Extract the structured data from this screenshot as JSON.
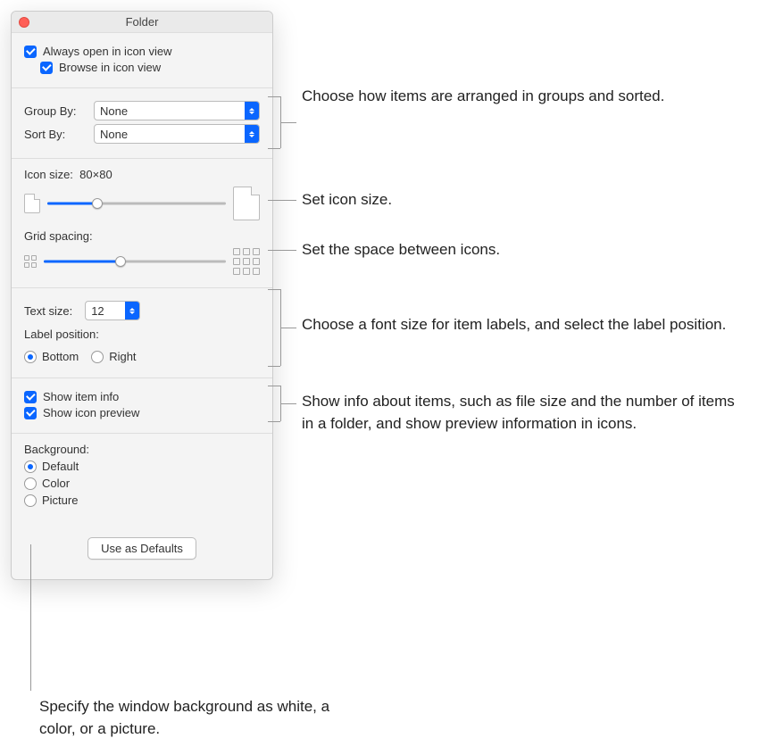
{
  "title": "Folder",
  "view": {
    "always_open_icon_view": "Always open in icon view",
    "browse_icon_view": "Browse in icon view"
  },
  "arrange": {
    "group_by_label": "Group By:",
    "group_by_value": "None",
    "sort_by_label": "Sort By:",
    "sort_by_value": "None"
  },
  "icon_size": {
    "label": "Icon size:",
    "value": "80×80",
    "slider_percent": 28
  },
  "grid_spacing": {
    "label": "Grid spacing:",
    "slider_percent": 42
  },
  "text": {
    "text_size_label": "Text size:",
    "text_size_value": "12",
    "label_position_label": "Label position:",
    "bottom": "Bottom",
    "right": "Right"
  },
  "info": {
    "show_item_info": "Show item info",
    "show_icon_preview": "Show icon preview"
  },
  "background": {
    "label": "Background:",
    "default": "Default",
    "color": "Color",
    "picture": "Picture"
  },
  "footer": {
    "use_defaults": "Use as Defaults"
  },
  "callouts": {
    "arrange": "Choose how items are arranged in groups and sorted.",
    "icon_size": "Set icon size.",
    "grid_spacing": "Set the space between icons.",
    "text": "Choose a font size for item labels, and select the label position.",
    "info": "Show info about items, such as file size and the number of items in a folder, and show preview information in icons.",
    "background": "Specify the window background as white, a color, or a picture."
  }
}
